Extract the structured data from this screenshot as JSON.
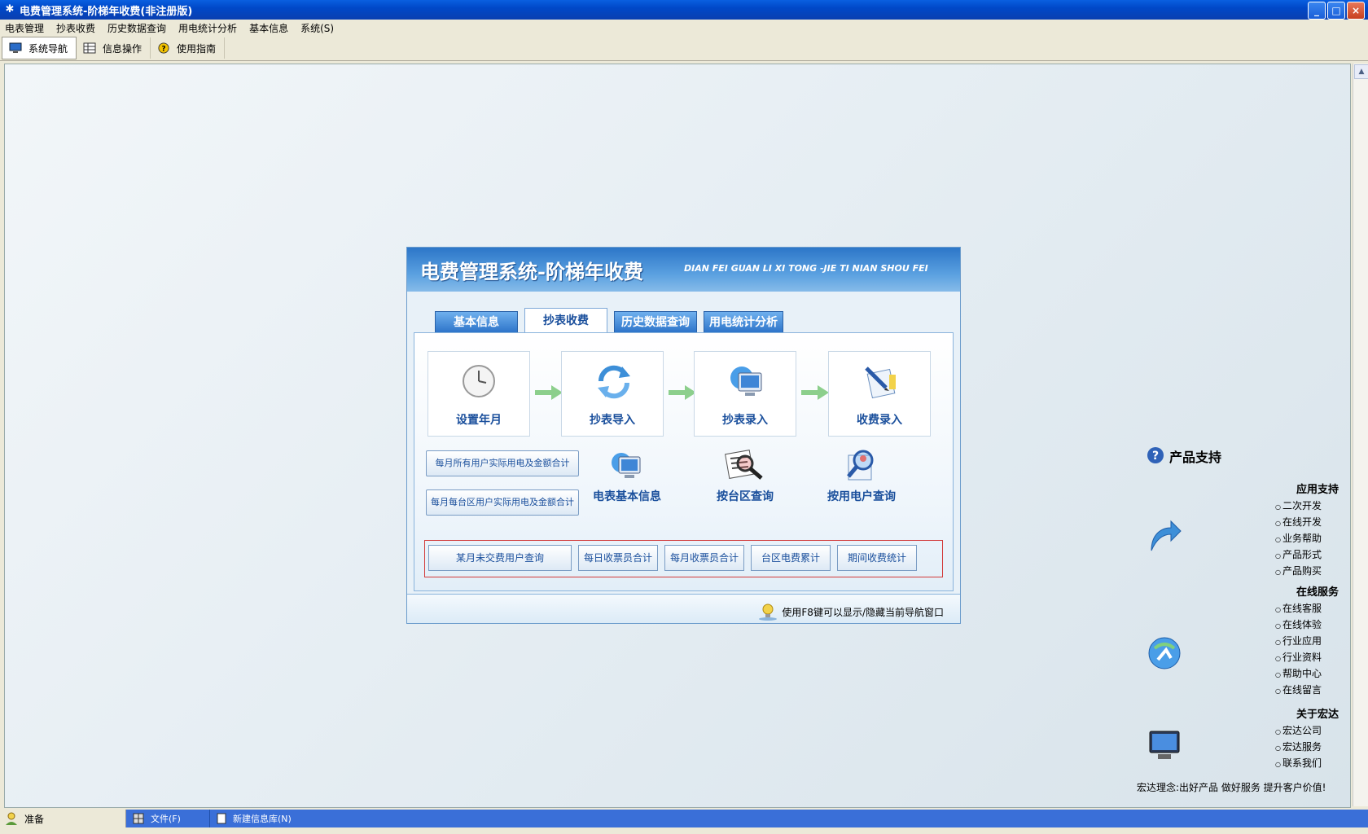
{
  "window": {
    "title": "电费管理系统-阶梯年收费(非注册版)",
    "btn_min": "_",
    "btn_max": "□",
    "btn_close": "×"
  },
  "menu": [
    "电表管理",
    "抄表收费",
    "历史数据查询",
    "用电统计分析",
    "基本信息",
    "系统(S)"
  ],
  "toolbar": {
    "nav": "系统导航",
    "info": "信息操作",
    "guide": "使用指南"
  },
  "panel": {
    "title": "电费管理系统-阶梯年收费",
    "title_en": "DIAN FEI GUAN LI XI TONG -JIE TI NIAN SHOU FEI",
    "tabs": [
      "基本信息",
      "抄表收费",
      "历史数据查询",
      "用电统计分析"
    ],
    "steps": [
      "设置年月",
      "抄表导入",
      "抄表录入",
      "收费录入"
    ],
    "sum_buttons": [
      "每月所有用户实际用电及金额合计",
      "每月每台区用户实际用电及金额合计"
    ],
    "queries": [
      "电表基本信息",
      "按台区查询",
      "按用电户查询"
    ],
    "bottom_buttons": [
      "某月未交费用户查询",
      "每日收票员合计",
      "每月收票员合计",
      "台区电费累计",
      "期间收费统计"
    ],
    "tip": "使用F8键可以显示/隐藏当前导航窗口"
  },
  "support": {
    "title": "产品支持",
    "sections": [
      {
        "heading": "应用支持",
        "items": [
          "二次开发",
          "在线开发",
          "业务帮助",
          "产品形式",
          "产品购买"
        ]
      },
      {
        "heading": "在线服务",
        "items": [
          "在线客服",
          "在线体验",
          "行业应用",
          "行业资料",
          "帮助中心",
          "在线留言"
        ]
      },
      {
        "heading": "关于宏达",
        "items": [
          "宏达公司",
          "宏达服务",
          "联系我们"
        ]
      }
    ],
    "motto": "宏达理念:出好产品  做好服务  提升客户价值!"
  },
  "statusbar": {
    "status": "准备",
    "file": "文件(F)",
    "db": "新建信息库(N)"
  },
  "colors": {
    "titlebar": "#0a5fe0",
    "accent": "#1a4f9c",
    "panel_border": "#6c9ccc",
    "red_frame": "#d23a3a"
  }
}
